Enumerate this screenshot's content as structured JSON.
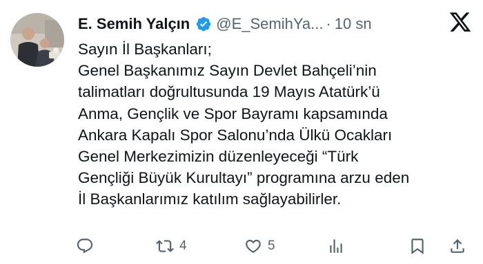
{
  "author": {
    "name": "E. Semih Yalçın",
    "handle": "@E_SemihYa...",
    "separator": "·",
    "time": "10 sn"
  },
  "tweet": {
    "lines": [
      "Sayın İl Başkanları;",
      "Genel Başkanımız Sayın Devlet Bahçeli’nin",
      "talimatları doğrultusunda 19 Mayıs Atatürk’ü",
      "Anma, Gençlik ve Spor Bayramı kapsamında",
      "Ankara Kapalı Spor Salonu’nda Ülkü Ocakları",
      "Genel Merkezimizin düzenleyeceği “Türk",
      "Gençliği Büyük Kurultayı” programına arzu eden",
      "İl Başkanlarımız katılım sağlayabilirler."
    ]
  },
  "actions": {
    "reply_icon": "reply-icon",
    "retweet_icon": "retweet-icon",
    "retweet_count": "4",
    "like_icon": "heart-icon",
    "like_count": "5",
    "views_icon": "views-icon",
    "bookmark_icon": "bookmark-icon",
    "share_icon": "share-icon"
  },
  "colors": {
    "text": "#0f1419",
    "secondary": "#536471",
    "verified": "#1d9bf0"
  }
}
